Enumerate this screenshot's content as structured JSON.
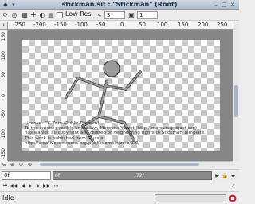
{
  "window": {
    "title": "stickman.sif : \"Stickman\" (Root)"
  },
  "toolbar": {
    "low_res_label": "Low Res",
    "low_res_checked": false,
    "zoom_value": "3",
    "grid_value": "1"
  },
  "ruler": {
    "h_ticks": [
      "-250",
      "-200",
      "-150",
      "-100",
      "-50",
      "0",
      "50",
      "100",
      "150",
      "200",
      "250"
    ],
    "v_ticks": [
      "150",
      "100",
      "50",
      "0",
      "-50",
      "-100",
      "-150"
    ]
  },
  "canvas": {
    "license_lines": [
      "License: CC Zero (Public Domain)",
      "To the extent possible under law, MorevnaProject (http://morevnaproject.org)",
      "has waived all copyright and related or neighboring rights to Stickman Template.",
      "This work is published from: Russia.",
      "http://creativecommons.org/publicdomain/zero/1.0/"
    ]
  },
  "time": {
    "current_frame": "0f",
    "timeline_start": "0f",
    "timeline_end": "72f"
  },
  "status": {
    "text": "Idle"
  }
}
